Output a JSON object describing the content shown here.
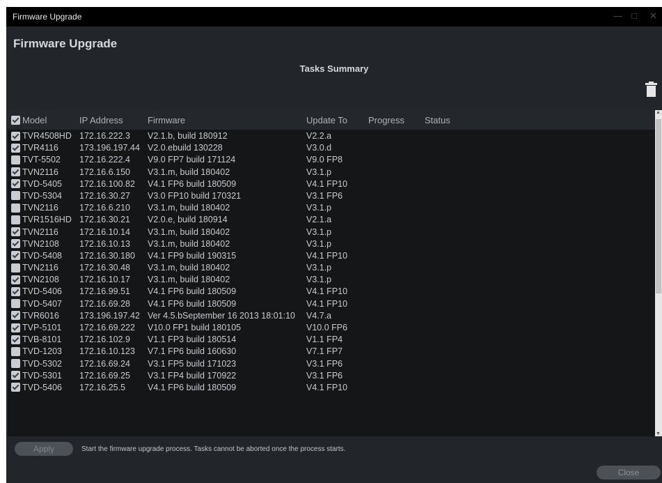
{
  "window": {
    "title": "Firmware Upgrade",
    "min_icon": "minimize-icon",
    "max_icon": "maximize-icon",
    "close_icon": "close-icon"
  },
  "heading": "Firmware Upgrade",
  "tasks_summary": "Tasks Summary",
  "toolbar": {
    "delete_icon": "trash-icon"
  },
  "table": {
    "headers": {
      "model": "Model",
      "ip": "IP Address",
      "firmware": "Firmware",
      "update_to": "Update To",
      "progress": "Progress",
      "status": "Status"
    },
    "select_all": true,
    "rows": [
      {
        "checked": true,
        "model": "TVR4508HD",
        "ip": "172.16.222.3",
        "firmware": "V2.1.b, build 180912",
        "update_to": "V2.2.a"
      },
      {
        "checked": true,
        "model": "TVR4116",
        "ip": "173.196.197.44",
        "firmware": "V2.0.ebuild 130228",
        "update_to": "V3.0.d"
      },
      {
        "checked": false,
        "model": "TVT-5502",
        "ip": "172.16.222.4",
        "firmware": "V9.0 FP7 build 171124",
        "update_to": "V9.0 FP8"
      },
      {
        "checked": true,
        "model": "TVN2116",
        "ip": "172.16.6.150",
        "firmware": "V3.1.m, build 180402",
        "update_to": "V3.1.p"
      },
      {
        "checked": true,
        "model": "TVD-5405",
        "ip": "172.16.100.82",
        "firmware": "V4.1 FP6 build 180509",
        "update_to": "V4.1 FP10"
      },
      {
        "checked": false,
        "model": "TVD-5304",
        "ip": "172.16.30.27",
        "firmware": "V3.0 FP10 build 170321",
        "update_to": "V3.1 FP6"
      },
      {
        "checked": false,
        "model": "TVN2116",
        "ip": "172.16.6.210",
        "firmware": "V3.1.m, build 180402",
        "update_to": "V3.1.p"
      },
      {
        "checked": false,
        "model": "TVR1516HD",
        "ip": "172.16.30.21",
        "firmware": "V2.0.e, build 180914",
        "update_to": "V2.1.a"
      },
      {
        "checked": true,
        "model": "TVN2116",
        "ip": "172.16.10.14",
        "firmware": "V3.1.m, build 180402",
        "update_to": "V3.1.p"
      },
      {
        "checked": true,
        "model": "TVN2108",
        "ip": "172.16.10.13",
        "firmware": "V3.1.m, build 180402",
        "update_to": "V3.1.p"
      },
      {
        "checked": true,
        "model": "TVD-5408",
        "ip": "172.16.30.180",
        "firmware": "V4.1 FP9 build 190315",
        "update_to": "V4.1 FP10"
      },
      {
        "checked": false,
        "model": "TVN2116",
        "ip": "172.16.30.48",
        "firmware": "V3.1.m, build 180402",
        "update_to": "V3.1.p"
      },
      {
        "checked": true,
        "model": "TVN2108",
        "ip": "172.16.10.17",
        "firmware": "V3.1.m, build 180402",
        "update_to": "V3.1.p"
      },
      {
        "checked": true,
        "model": "TVD-5406",
        "ip": "172.16.99.51",
        "firmware": "V4.1 FP6 build 180509",
        "update_to": "V4.1 FP10"
      },
      {
        "checked": false,
        "model": "TVD-5407",
        "ip": "172.16.69.28",
        "firmware": "V4.1 FP6 build 180509",
        "update_to": "V4.1 FP10"
      },
      {
        "checked": true,
        "model": "TVR6016",
        "ip": "173.196.197.42",
        "firmware": "Ver 4.5.bSeptember 16 2013 18:01:10",
        "update_to": "V4.7.a"
      },
      {
        "checked": true,
        "model": "TVP-5101",
        "ip": "172.16.69.222",
        "firmware": "V10.0 FP1 build 180105",
        "update_to": "V10.0 FP6"
      },
      {
        "checked": true,
        "model": "TVB-8101",
        "ip": "172.16.102.9",
        "firmware": "V1.1 FP3 build 180514",
        "update_to": "V1.1 FP4"
      },
      {
        "checked": false,
        "model": "TVD-1203",
        "ip": "172.16.10.123",
        "firmware": "V7.1 FP6 build 160630",
        "update_to": "V7.1 FP7"
      },
      {
        "checked": false,
        "model": "TVD-5302",
        "ip": "172.16.69.24",
        "firmware": "V3.1 FP5 build 171023",
        "update_to": "V3.1 FP6"
      },
      {
        "checked": true,
        "model": "TVD-5301",
        "ip": "172.16.69.25",
        "firmware": "V3.1 FP4 build 170922",
        "update_to": "V3.1 FP6"
      },
      {
        "checked": true,
        "model": "TVD-5406",
        "ip": "172.16.25.5",
        "firmware": "V4.1 FP6 build 180509",
        "update_to": "V4.1 FP10"
      }
    ]
  },
  "footer": {
    "apply_label": "Apply",
    "apply_note": "Start the firmware upgrade process.  Tasks cannot be aborted once the process starts.",
    "close_label": "Close"
  }
}
